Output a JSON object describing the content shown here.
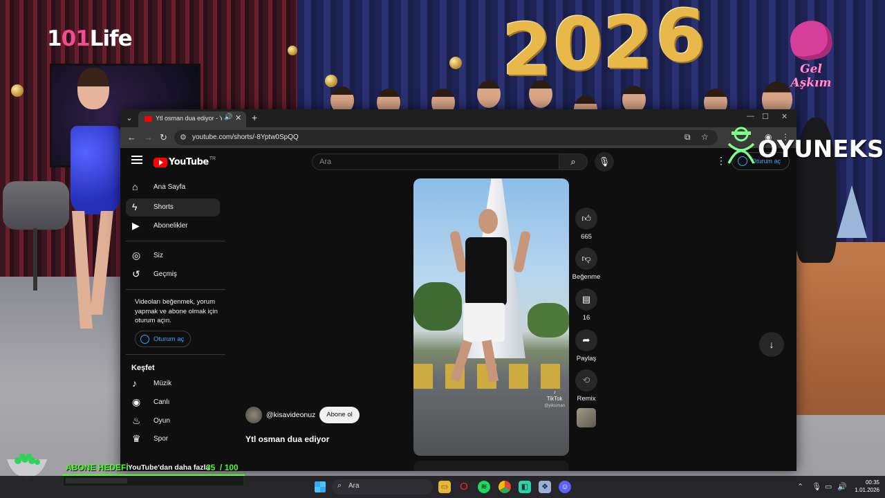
{
  "broadcast": {
    "channel_logo_prefix": "1",
    "channel_logo_num": "01",
    "channel_logo_suffix": "Life",
    "show_logo": "Gel Aşkım",
    "balloons": [
      "2",
      "0",
      "2",
      "6"
    ],
    "sponsor_logo": "OYUNEKS",
    "goal": {
      "label": "ABONE HEDEFİ",
      "current": 35,
      "target": 100,
      "current_text": "35",
      "target_text": "/ 100",
      "fill_fraction": 0.35,
      "color": "#4dff2a"
    }
  },
  "browser": {
    "tab": {
      "title": "Ytl osman dua ediyor - YouTube",
      "audio_icon": "speaker-icon",
      "close_icon": "close-icon"
    },
    "new_tab_label": "+",
    "url": "youtube.com/shorts/-8Yptw0SpQQ"
  },
  "youtube": {
    "logo_text": "YouTube",
    "country_code": "TR",
    "search": {
      "placeholder": "Ara",
      "value": ""
    },
    "signin_label": "Oturum aç",
    "sidebar": {
      "primary": [
        {
          "label": "Ana Sayfa",
          "icon": "home-icon",
          "active": false
        },
        {
          "label": "Shorts",
          "icon": "shorts-icon",
          "active": true
        },
        {
          "label": "Abonelikler",
          "icon": "subscriptions-icon",
          "active": false
        }
      ],
      "secondary": [
        {
          "label": "Siz",
          "icon": "account-icon"
        },
        {
          "label": "Geçmiş",
          "icon": "history-icon"
        }
      ],
      "signin_note": "Videoları beğenmek, yorum yapmak ve abone olmak için oturum açın.",
      "signin_button": "Oturum aç",
      "explore_heading": "Keşfet",
      "explore": [
        {
          "label": "Müzik",
          "icon": "music-icon"
        },
        {
          "label": "Canlı",
          "icon": "live-icon"
        },
        {
          "label": "Oyun",
          "icon": "gaming-icon"
        },
        {
          "label": "Spor",
          "icon": "trophy-icon"
        }
      ],
      "more_from_youtube": "YouTube'dan daha fazla"
    },
    "short": {
      "channel_handle": "@kisavideonuz",
      "subscribe_label": "Abone ol",
      "title": "Ytl osman dua ediyor",
      "watermark": "TikTok",
      "watermark_sub": "@yilosman",
      "actions": {
        "like_count": "665",
        "dislike_label": "Beğenme",
        "comment_count": "16",
        "share_label": "Paylaş",
        "remix_label": "Remix"
      }
    }
  },
  "taskbar": {
    "search_placeholder": "Ara",
    "apps": [
      "file-explorer-icon",
      "opera-icon",
      "spotify-icon",
      "chrome-icon",
      "app-icon",
      "app-icon-2",
      "discord-icon"
    ],
    "time": "00:35",
    "date": "1.01.2026"
  },
  "colors": {
    "yt_red": "#ff0000",
    "link_blue": "#3ea6ff",
    "goal_green": "#4dff2a"
  }
}
